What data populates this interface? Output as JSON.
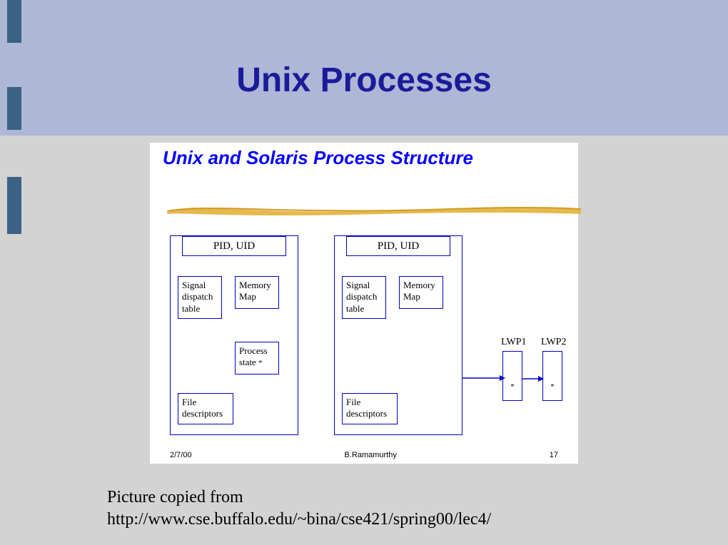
{
  "slide": {
    "title": "Unix Processes",
    "caption_line1": "Picture copied from",
    "caption_line2": "http://www.cse.buffalo.edu/~bina/cse421/spring00/lec4/"
  },
  "inner": {
    "title": "Unix and Solaris Process Structure",
    "footer": {
      "date": "2/7/00",
      "author": "B.Ramamurthy",
      "page": "17"
    },
    "proc_a": {
      "header": "PID, UID",
      "signal": "Signal dispatch table",
      "memory": "Memory Map",
      "pstate_line1": "Process",
      "pstate_line2": "state",
      "fd": "File descriptors"
    },
    "proc_b": {
      "header": "PID, UID",
      "signal": "Signal dispatch table",
      "memory": "Memory Map",
      "fd": "File descriptors"
    },
    "lwp": {
      "label1": "LWP1",
      "label2": "LWP2",
      "star": "*"
    }
  }
}
